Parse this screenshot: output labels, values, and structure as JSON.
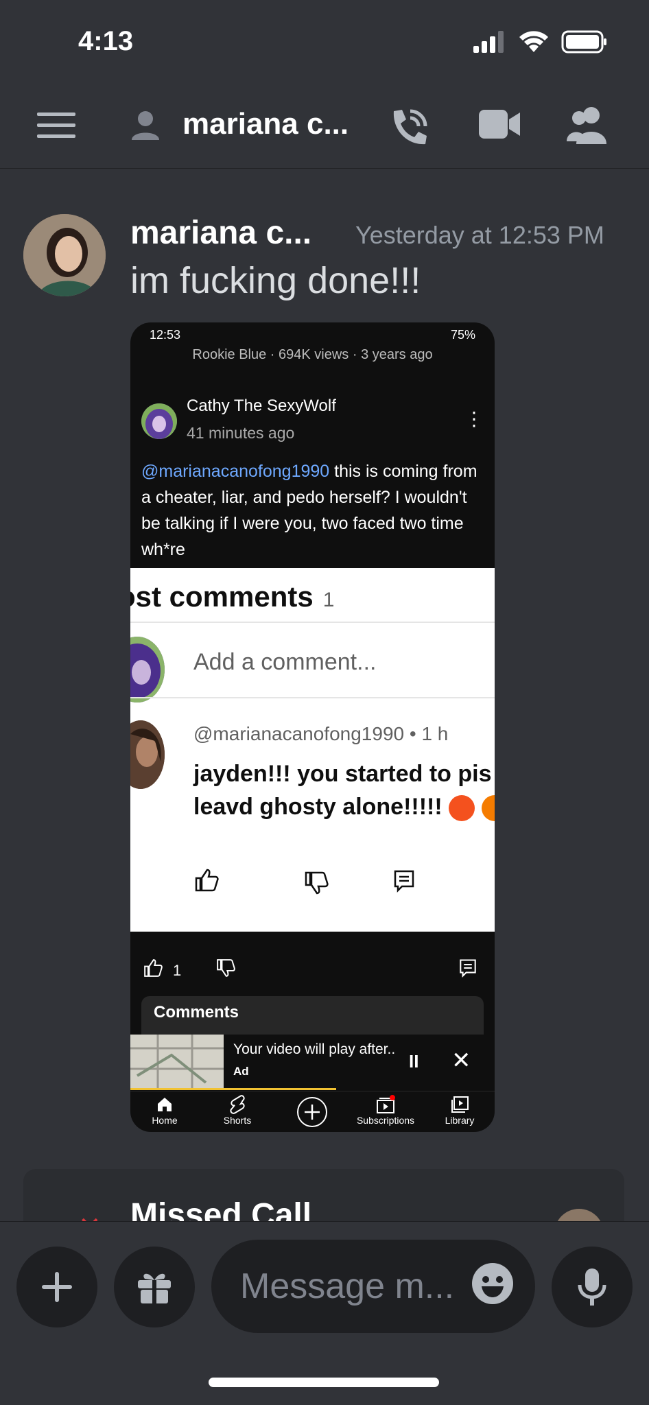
{
  "status": {
    "time": "4:13"
  },
  "nav": {
    "title": "mariana c..."
  },
  "message": {
    "author": "mariana c...",
    "timestamp": "Yesterday at 12:53 PM",
    "text": "im fucking done!!!"
  },
  "screenshot": {
    "status_time": "12:53",
    "battery": "75%",
    "video_meta": "Rookie Blue · 694K views · 3 years ago",
    "commenter_name": "Cathy The SexyWolf",
    "commenter_time": "41 minutes ago",
    "comment_mention": "@marianacanofong1990",
    "comment_body": " this is coming from a cheater, liar, and pedo herself? I wouldn't be talking if I were you, two faced two time wh*re",
    "yt_header": "ost comments",
    "yt_header_count": "1",
    "add_comment_placeholder": "Add a comment...",
    "reply_handle": "@marianacanofong1990  •  1 h",
    "reply_line1": "jayden!!! you started to pis",
    "reply_line2": "leavd ghosty alone!!!!!",
    "like_count": "1",
    "comments_label": "Comments",
    "ad_title": "Your video will play after..",
    "ad_badge": "Ad",
    "tabs": [
      "Home",
      "Shorts",
      "",
      "Subscriptions",
      "Library"
    ]
  },
  "missed_call": {
    "title": "Missed Call"
  },
  "composer": {
    "placeholder": "Message m..."
  },
  "colors": {
    "background": "#313338",
    "card": "#2b2d31",
    "input": "#1e1f22",
    "missed": "#da373c"
  }
}
